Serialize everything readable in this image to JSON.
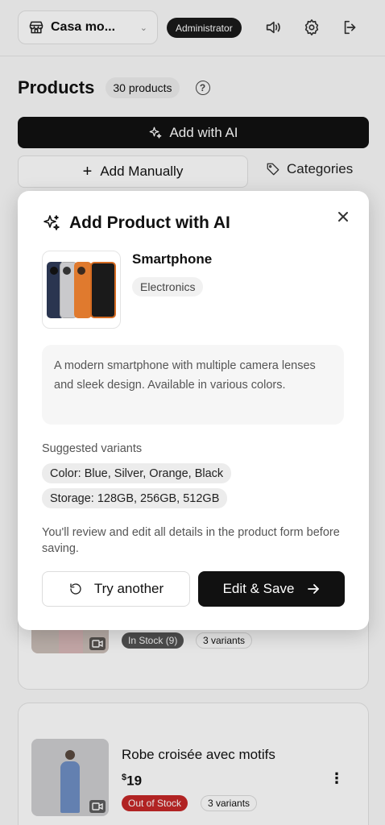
{
  "header": {
    "store_name": "Casa mo...",
    "role_badge": "Administrator",
    "icons": [
      "speaker-icon",
      "gear-icon",
      "logout-icon"
    ]
  },
  "products": {
    "title": "Products",
    "count": "30 products",
    "help_symbol": "?",
    "add_ai_label": "Add with AI",
    "add_manual_label": "Add Manually",
    "categories_label": "Categories"
  },
  "list": [
    {
      "stock": "In Stock (9)",
      "variants": "3 variants",
      "stock_color": "#555555"
    },
    {
      "name": "Robe croisée avec motifs",
      "price_currency": "$",
      "price_value": "19",
      "stock": "Out of Stock",
      "variants": "3 variants",
      "stock_color": "#c62828"
    }
  ],
  "modal": {
    "title": "Add Product with AI",
    "product_name": "Smartphone",
    "category": "Electronics",
    "description": "A modern smartphone with multiple camera lenses and sleek design. Available in various colors.",
    "variants_label": "Suggested variants",
    "variants": [
      "Color: Blue, Silver, Orange, Black",
      "Storage: 128GB, 256GB, 512GB"
    ],
    "review_note": "You'll review and edit all details in the product form before saving.",
    "try_another_label": "Try another",
    "edit_save_label": "Edit & Save"
  },
  "colors": {
    "primary_button": "#111111",
    "out_of_stock": "#c62828"
  }
}
